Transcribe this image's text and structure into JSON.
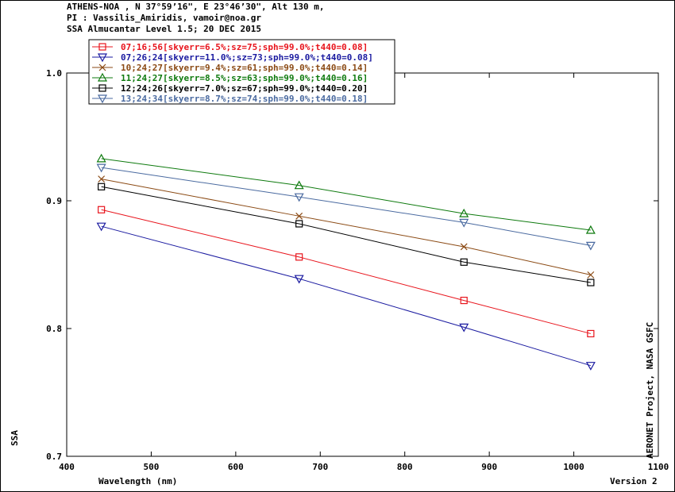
{
  "header": {
    "line1": "ATHENS-NOA , N 37°59’16\", E 23°46’30\", Alt 130 m,",
    "line2": "PI : Vassilis_Amiridis, vamoir@noa.gr",
    "line3": "SSA Almucantar Level 1.5; 20 DEC 2015"
  },
  "side_label": "AERONET Project, NASA GSFC",
  "version_label": "Version 2",
  "chart_data": {
    "type": "line",
    "xlabel": "Wavelength (nm)",
    "ylabel": "SSA",
    "xlim": [
      400,
      1100
    ],
    "ylim": [
      0.7,
      1.0
    ],
    "x_ticks": [
      400,
      500,
      600,
      700,
      800,
      900,
      1000,
      1100
    ],
    "y_ticks": [
      0.7,
      0.8,
      0.9,
      1.0
    ],
    "y_tick_labels": [
      "0.7",
      "0.8",
      "0.9",
      "1.0"
    ],
    "grid": false,
    "legend_position": "top-left",
    "x": [
      441,
      675,
      870,
      1020
    ],
    "series": [
      {
        "name": "07;16;56[skyerr=6.5%;sz=75;sph=99.0%;t440=0.08]",
        "color": "#e8141c",
        "marker": "square",
        "values": [
          0.893,
          0.856,
          0.822,
          0.796
        ]
      },
      {
        "name": "07;26;24[skyerr=11.0%;sz=73;sph=99.0%;t440=0.08]",
        "color": "#1a1aa0",
        "marker": "triangle-down",
        "values": [
          0.88,
          0.839,
          0.801,
          0.771
        ]
      },
      {
        "name": "10;24;27[skyerr=9.4%;sz=61;sph=99.0%;t440=0.14]",
        "color": "#8b4a14",
        "marker": "x",
        "values": [
          0.917,
          0.888,
          0.864,
          0.842
        ]
      },
      {
        "name": "11;24;27[skyerr=8.5%;sz=63;sph=99.0%;t440=0.16]",
        "color": "#0e7a0e",
        "marker": "triangle-up",
        "values": [
          0.933,
          0.912,
          0.89,
          0.877
        ]
      },
      {
        "name": "12;24;26[skyerr=7.0%;sz=67;sph=99.0%;t440=0.20]",
        "color": "#000000",
        "marker": "square",
        "values": [
          0.911,
          0.882,
          0.852,
          0.836
        ]
      },
      {
        "name": "13;24;34[skyerr=8.7%;sz=74;sph=99.0%;t440=0.18]",
        "color": "#4a6aa0",
        "marker": "triangle-down",
        "values": [
          0.926,
          0.903,
          0.883,
          0.865
        ]
      }
    ]
  }
}
